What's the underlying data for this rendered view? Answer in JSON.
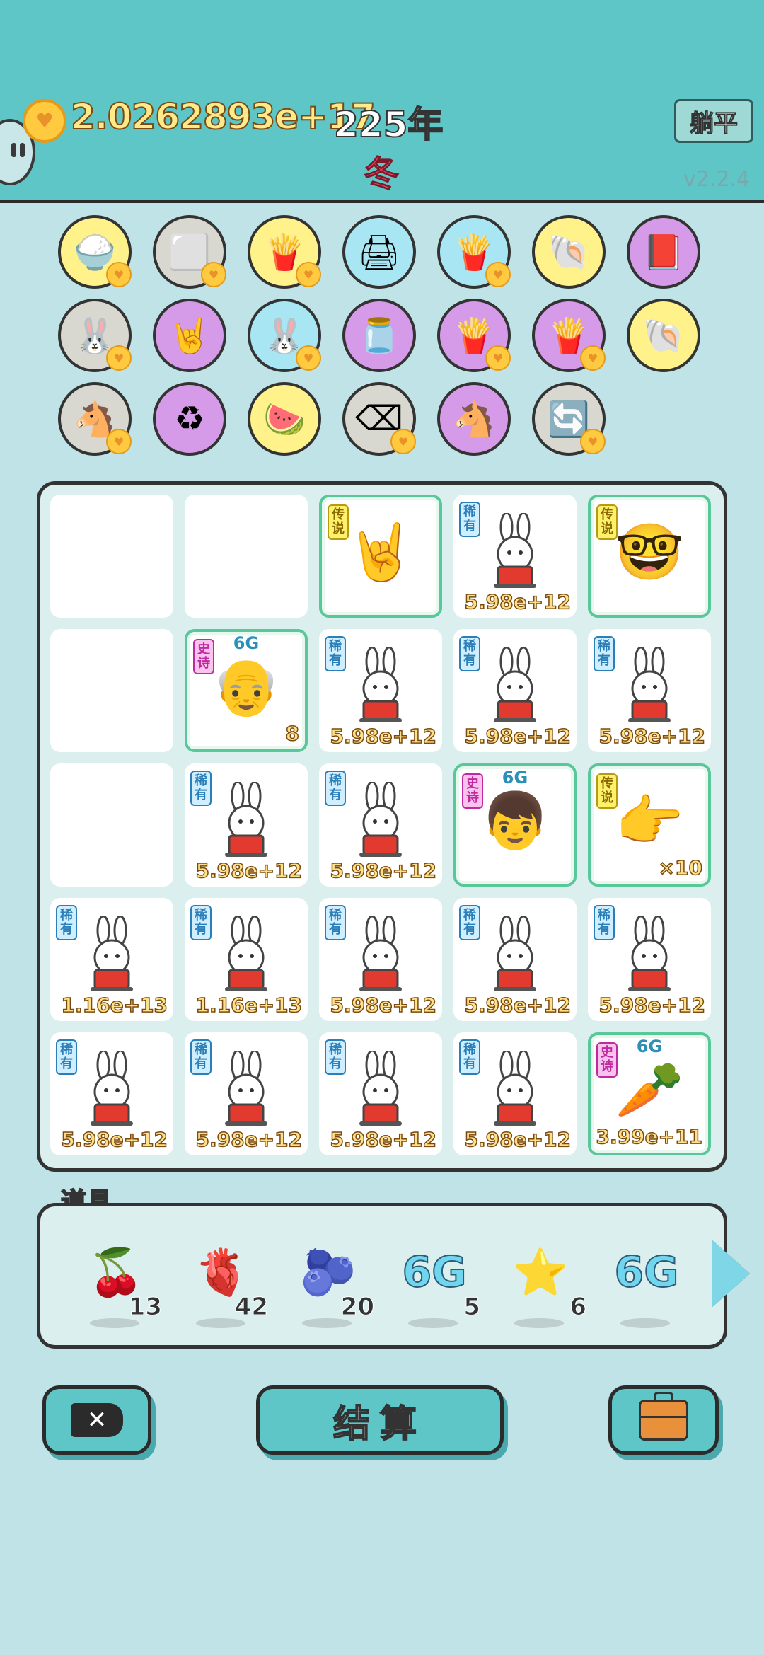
{
  "header": {
    "coins": "2.0262893e+17",
    "year": "225年",
    "season": "冬",
    "lie_flat_label": "躺平",
    "version": "v2.2.4"
  },
  "symbol_icons": [
    {
      "name": "rice-bowl-icon",
      "glyph": "🍚",
      "bg": "yellow",
      "heart": true
    },
    {
      "name": "sugar-cubes-icon",
      "glyph": "⬜",
      "bg": "gray",
      "heart": true
    },
    {
      "name": "fries-icon",
      "glyph": "🍟",
      "bg": "yellow",
      "heart": true
    },
    {
      "name": "printer-icon",
      "glyph": "🖨",
      "bg": "blue",
      "heart": false
    },
    {
      "name": "fries-icon",
      "glyph": "🍟",
      "bg": "blue",
      "heart": true
    },
    {
      "name": "shell-icon",
      "glyph": "🐚",
      "bg": "yellow",
      "heart": false
    },
    {
      "name": "time-magazine-icon",
      "glyph": "📕",
      "bg": "purple",
      "heart": false
    },
    {
      "name": "bunny-icon",
      "glyph": "🐰",
      "bg": "gray",
      "heart": true
    },
    {
      "name": "rock-hand-icon",
      "glyph": "🤘",
      "bg": "purple",
      "heart": false
    },
    {
      "name": "bunny-icon",
      "glyph": "🐰",
      "bg": "blue",
      "heart": true
    },
    {
      "name": "jar-icon",
      "glyph": "🫙",
      "bg": "purple",
      "heart": false
    },
    {
      "name": "fries-icon",
      "glyph": "🍟",
      "bg": "purple",
      "heart": true
    },
    {
      "name": "fries-icon",
      "glyph": "🍟",
      "bg": "purple",
      "heart": true
    },
    {
      "name": "shell-icon",
      "glyph": "🐚",
      "bg": "yellow",
      "heart": false
    },
    {
      "name": "horse-pair-icon",
      "glyph": "🐴",
      "bg": "gray",
      "heart": true
    },
    {
      "name": "recycle-icon",
      "glyph": "♻",
      "bg": "purple",
      "heart": false
    },
    {
      "name": "fruit-platter-icon",
      "glyph": "🍉",
      "bg": "yellow",
      "heart": false
    },
    {
      "name": "delete-key-icon",
      "glyph": "⌫",
      "bg": "gray",
      "heart": true
    },
    {
      "name": "horse-pair-icon",
      "glyph": "🐴",
      "bg": "purple",
      "heart": false
    },
    {
      "name": "refresh-icon",
      "glyph": "🔄",
      "bg": "gray",
      "heart": true
    }
  ],
  "board": {
    "cells": [
      {
        "kind": "empty"
      },
      {
        "kind": "empty"
      },
      {
        "kind": "hand-rock",
        "tag": "传说",
        "tag_type": "legend",
        "value": "",
        "green": true
      },
      {
        "kind": "bunny",
        "tag": "稀有",
        "tag_type": "rare",
        "value": "5.98e+12"
      },
      {
        "kind": "bald-glasses",
        "tag": "传说",
        "tag_type": "legend",
        "value": "",
        "green": true
      },
      {
        "kind": "empty"
      },
      {
        "kind": "old-man",
        "tag": "史诗",
        "tag_type": "epic",
        "six_g": true,
        "value": "8",
        "green": true
      },
      {
        "kind": "bunny",
        "tag": "稀有",
        "tag_type": "rare",
        "value": "5.98e+12"
      },
      {
        "kind": "bunny",
        "tag": "稀有",
        "tag_type": "rare",
        "value": "5.98e+12"
      },
      {
        "kind": "bunny",
        "tag": "稀有",
        "tag_type": "rare",
        "value": "5.98e+12"
      },
      {
        "kind": "empty"
      },
      {
        "kind": "bunny",
        "tag": "稀有",
        "tag_type": "rare",
        "value": "5.98e+12"
      },
      {
        "kind": "bunny",
        "tag": "稀有",
        "tag_type": "rare",
        "value": "5.98e+12"
      },
      {
        "kind": "red-hat-boy",
        "tag": "史诗",
        "tag_type": "epic",
        "six_g": true,
        "value": "",
        "green": true
      },
      {
        "kind": "hand-point",
        "tag": "传说",
        "tag_type": "legend",
        "value": "×10",
        "green": true
      },
      {
        "kind": "bunny",
        "tag": "稀有",
        "tag_type": "rare",
        "value": "1.16e+13"
      },
      {
        "kind": "bunny",
        "tag": "稀有",
        "tag_type": "rare",
        "value": "1.16e+13"
      },
      {
        "kind": "bunny",
        "tag": "稀有",
        "tag_type": "rare",
        "value": "5.98e+12"
      },
      {
        "kind": "bunny",
        "tag": "稀有",
        "tag_type": "rare",
        "value": "5.98e+12"
      },
      {
        "kind": "bunny",
        "tag": "稀有",
        "tag_type": "rare",
        "value": "5.98e+12"
      },
      {
        "kind": "bunny",
        "tag": "稀有",
        "tag_type": "rare",
        "value": "5.98e+12"
      },
      {
        "kind": "bunny",
        "tag": "稀有",
        "tag_type": "rare",
        "value": "5.98e+12"
      },
      {
        "kind": "bunny",
        "tag": "稀有",
        "tag_type": "rare",
        "value": "5.98e+12"
      },
      {
        "kind": "bunny",
        "tag": "稀有",
        "tag_type": "rare",
        "value": "5.98e+12"
      },
      {
        "kind": "carrot-king",
        "tag": "史诗",
        "tag_type": "epic",
        "six_g": true,
        "value": "3.99e+11",
        "green": true
      }
    ]
  },
  "props": {
    "label": "道具",
    "items": [
      {
        "name": "lychee-icon",
        "glyph": "🍒",
        "count": "13"
      },
      {
        "name": "liver-icon",
        "glyph": "🫀",
        "count": "42"
      },
      {
        "name": "blueberry-icon",
        "glyph": "🫐",
        "count": "20"
      },
      {
        "name": "six-g-icon",
        "glyph": "6G",
        "count": "5"
      },
      {
        "name": "star-icon",
        "glyph": "⭐",
        "count": "6"
      },
      {
        "name": "six-g-icon",
        "glyph": "6G",
        "count": ""
      }
    ]
  },
  "buttons": {
    "settle_label": "结算"
  },
  "glyphs": {
    "six_g_text": "6G",
    "hand_rock": "🤘",
    "hand_point": "👉",
    "bald_glasses": "🤓",
    "old_man": "👴",
    "red_hat_boy": "👦",
    "carrot": "🥕",
    "close_x": "✕"
  }
}
